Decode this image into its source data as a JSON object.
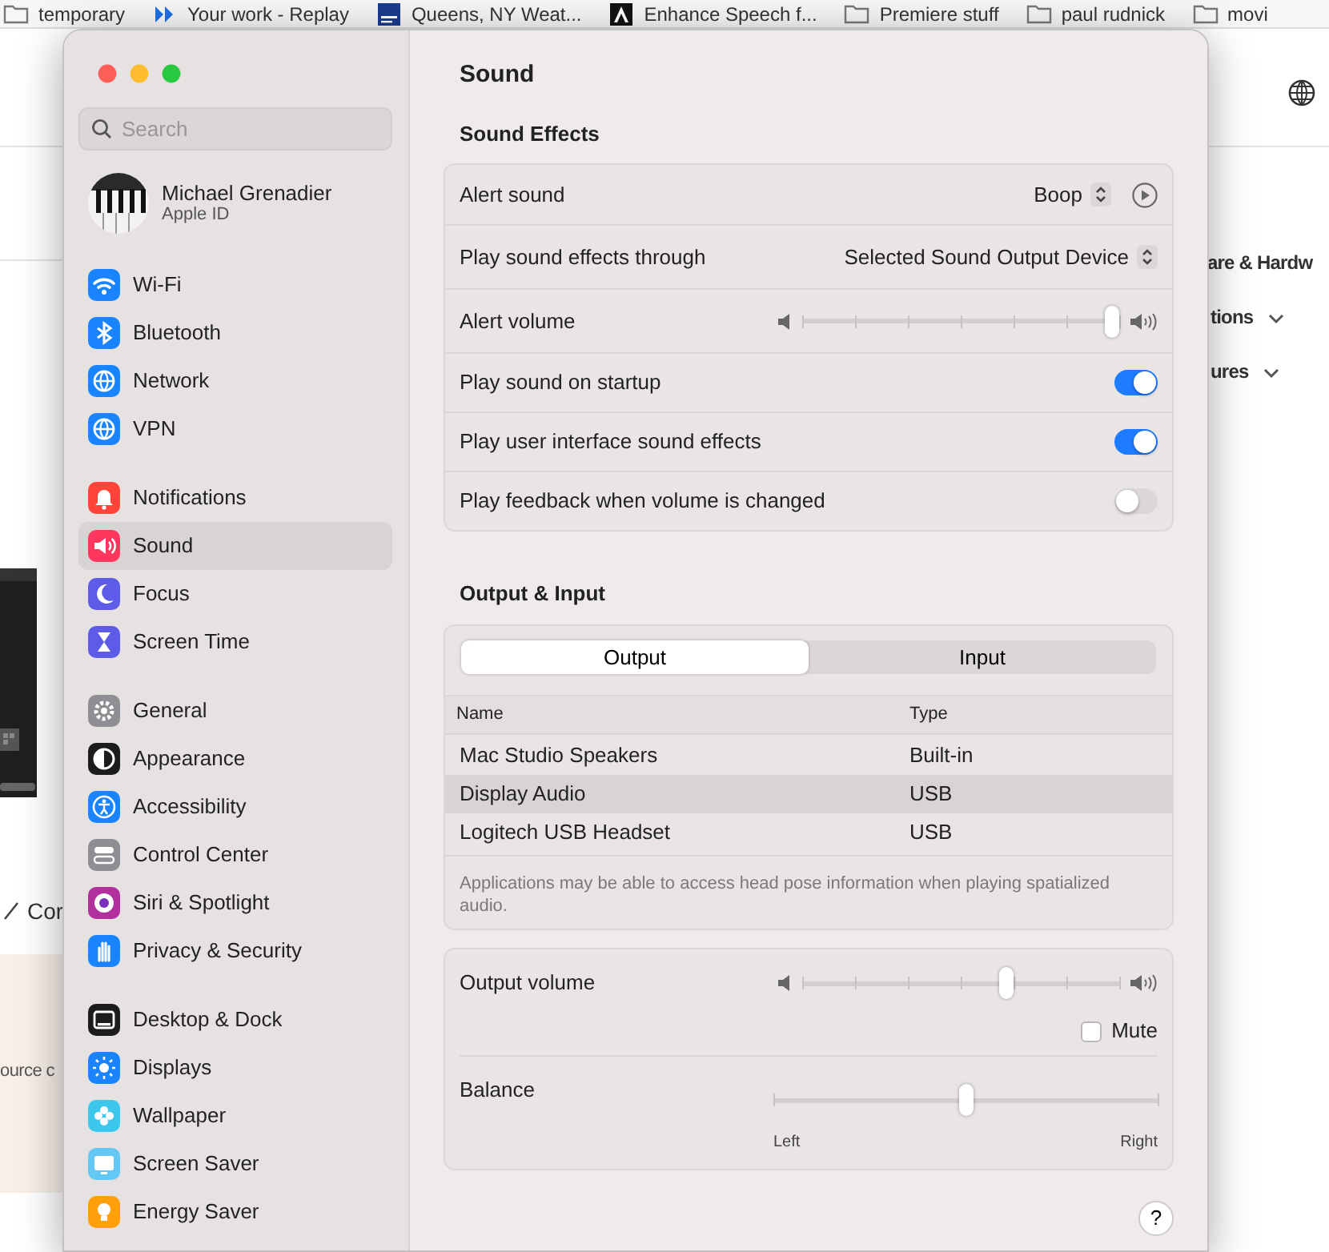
{
  "browser": {
    "bookmarks": [
      {
        "label": "temporary",
        "kind": "folder"
      },
      {
        "label": "Your work - Replay",
        "kind": "replay"
      },
      {
        "label": "Queens, NY Weat...",
        "kind": "weather"
      },
      {
        "label": "Enhance Speech f...",
        "kind": "adobe"
      },
      {
        "label": "Premiere stuff",
        "kind": "folder"
      },
      {
        "label": "paul rudnick",
        "kind": "folder"
      },
      {
        "label": "movi",
        "kind": "folder"
      }
    ]
  },
  "background_page": {
    "left_texts": [
      "Cor",
      "ource c"
    ],
    "right_texts": [
      "are & Hardw",
      "tions",
      "ures"
    ]
  },
  "sidebar": {
    "search": {
      "placeholder": "Search"
    },
    "profile": {
      "name": "Michael Grenadier",
      "subtitle": "Apple ID"
    },
    "groups": [
      [
        {
          "label": "Wi-Fi",
          "color": "#1a84ff",
          "selected": false
        },
        {
          "label": "Bluetooth",
          "color": "#1a84ff",
          "selected": false
        },
        {
          "label": "Network",
          "color": "#1a84ff",
          "selected": false
        },
        {
          "label": "VPN",
          "color": "#1a84ff",
          "selected": false
        }
      ],
      [
        {
          "label": "Notifications",
          "color": "#ff453a",
          "selected": false
        },
        {
          "label": "Sound",
          "color": "#ff375f",
          "selected": true
        },
        {
          "label": "Focus",
          "color": "#5e5ce6",
          "selected": false
        },
        {
          "label": "Screen Time",
          "color": "#5e5ce6",
          "selected": false
        }
      ],
      [
        {
          "label": "General",
          "color": "#8e8e93",
          "selected": false
        },
        {
          "label": "Appearance",
          "color": "#1c1c1e",
          "selected": false
        },
        {
          "label": "Accessibility",
          "color": "#1a84ff",
          "selected": false
        },
        {
          "label": "Control Center",
          "color": "#8e8e93",
          "selected": false
        },
        {
          "label": "Siri & Spotlight",
          "color": "#b2309e",
          "selected": false
        },
        {
          "label": "Privacy & Security",
          "color": "#1a84ff",
          "selected": false
        }
      ],
      [
        {
          "label": "Desktop & Dock",
          "color": "#1c1c1e",
          "selected": false
        },
        {
          "label": "Displays",
          "color": "#1a84ff",
          "selected": false
        },
        {
          "label": "Wallpaper",
          "color": "#3cc8ec",
          "selected": false
        },
        {
          "label": "Screen Saver",
          "color": "#64c8f5",
          "selected": false
        },
        {
          "label": "Energy Saver",
          "color": "#ff9f0a",
          "selected": false
        }
      ]
    ]
  },
  "pane": {
    "title": "Sound",
    "sound_effects": {
      "heading": "Sound Effects",
      "rows": [
        {
          "kind": "popup_play",
          "label": "Alert sound",
          "value": "Boop"
        },
        {
          "kind": "popup",
          "label": "Play sound effects through",
          "value": "Selected Sound Output Device"
        },
        {
          "kind": "slider",
          "label": "Alert volume",
          "level": 1
        },
        {
          "kind": "toggle",
          "label": "Play sound on startup",
          "on": true
        },
        {
          "kind": "toggle",
          "label": "Play user interface sound effects",
          "on": true
        },
        {
          "kind": "toggle",
          "label": "Play feedback when volume is changed",
          "on": false
        }
      ]
    },
    "output_input": {
      "heading": "Output & Input",
      "tabs": [
        {
          "label": "Output",
          "selected": true
        },
        {
          "label": "Input",
          "selected": false
        }
      ],
      "columns": [
        "Name",
        "Type"
      ],
      "devices": [
        {
          "name": "Mac Studio Speakers",
          "type": "Built-in",
          "selected": false
        },
        {
          "name": "Display Audio",
          "type": "USB",
          "selected": true
        },
        {
          "name": "Logitech USB Headset",
          "type": "USB",
          "selected": false
        }
      ],
      "note": "Applications may be able to access head pose information when playing spatialized audio."
    },
    "output_volume": {
      "label": "Output volume",
      "level": 0.65
    },
    "mute": {
      "label": "Mute",
      "checked": false
    },
    "balance": {
      "label": "Balance",
      "level": 0.5,
      "left": "Left",
      "right": "Right"
    },
    "help": "?"
  }
}
